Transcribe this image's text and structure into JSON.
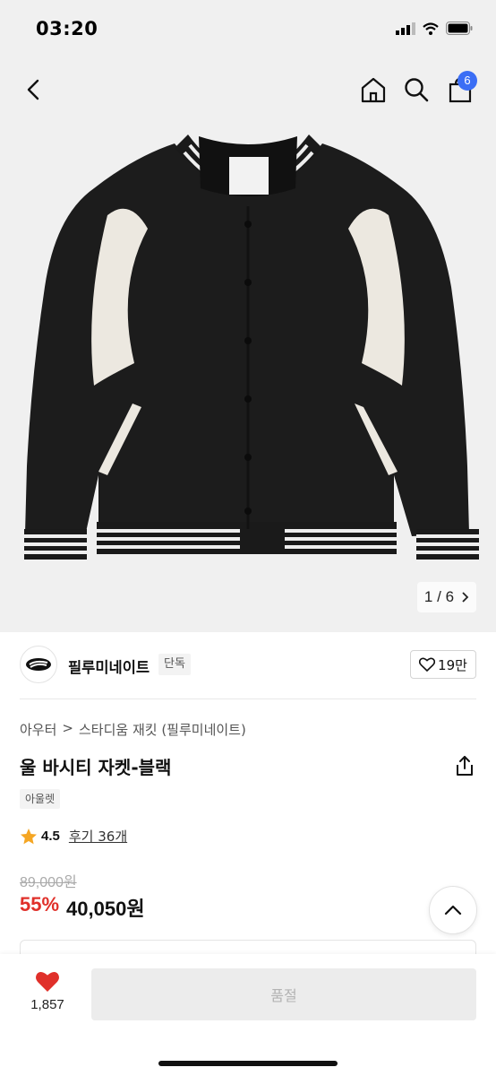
{
  "status_bar": {
    "time": "03:20"
  },
  "header": {
    "cart_badge": "6",
    "icons": [
      "back-icon",
      "home-icon",
      "search-icon",
      "shopping-bag-icon"
    ]
  },
  "gallery": {
    "current": "1",
    "separator": "/",
    "total": "6",
    "next_icon": "chevron-right-icon"
  },
  "brand": {
    "name": "필루미네이트",
    "tag": "단독",
    "likes": "19만",
    "like_icon": "heart-outline-icon"
  },
  "product": {
    "breadcrumb": [
      "아우터",
      "스타디움 재킷 (필루미네이트)"
    ],
    "title": "울 바시티 자켓-블랙",
    "tag": "아울렛",
    "rating": "4.5",
    "reviews": "후기 36개",
    "original_price": "89,000원",
    "discount": "55%",
    "sale_price": "40,050원"
  },
  "bottom_bar": {
    "wish_count": "1,857",
    "purchase_label": "품절"
  },
  "colors": {
    "accent": "#3b6ef5",
    "discount": "#e0302a",
    "heart": "#e0302a",
    "star": "#f5a623"
  }
}
